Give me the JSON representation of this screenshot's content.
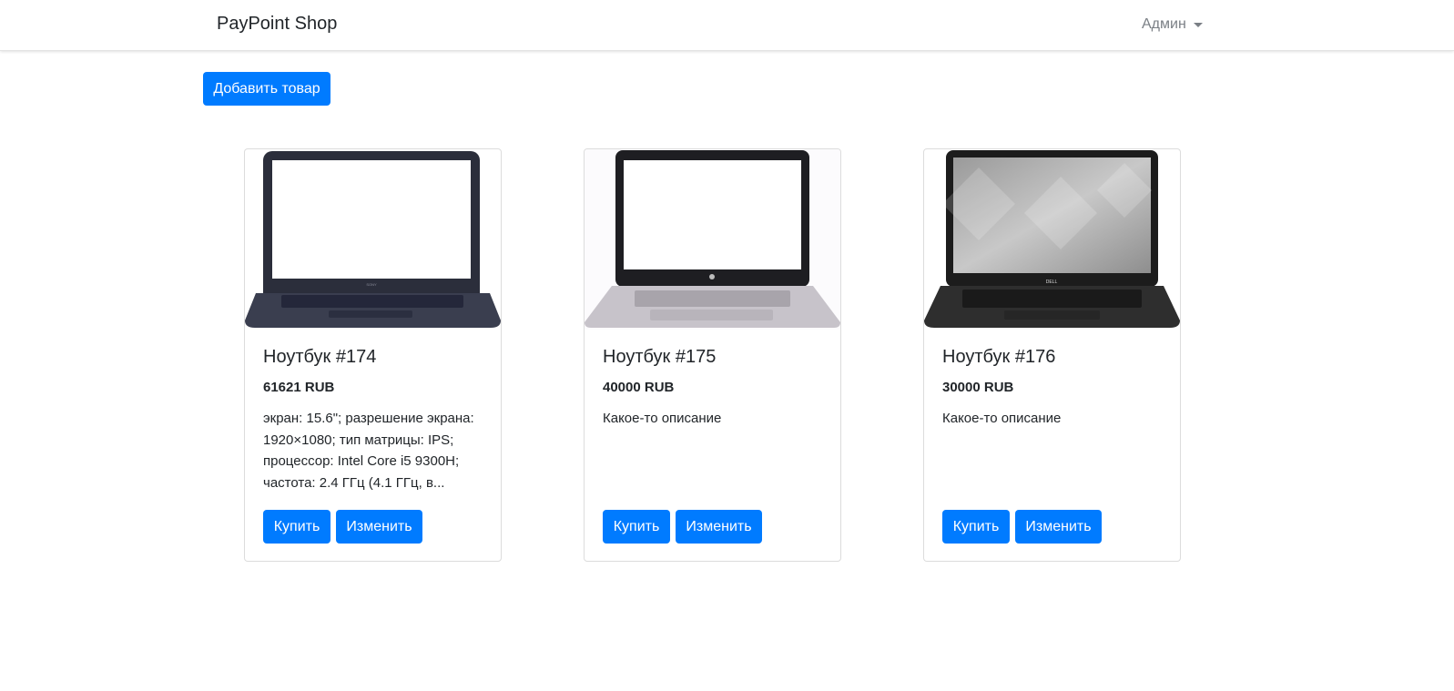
{
  "navbar": {
    "brand": "PayPoint Shop",
    "user_menu": "Админ",
    "user_menu_icon": "chevron-down-icon"
  },
  "toolbar": {
    "add_label": "Добавить товар"
  },
  "products": [
    {
      "title": "Ноутбук #174",
      "price": "61621 RUB",
      "description": "экран: 15.6\"; разрешение экрана: 1920×1080; тип матрицы: IPS; процессор: Intel Core i5 9300H; частота: 2.4 ГГц (4.1 ГГц, в...",
      "buy_label": "Купить",
      "edit_label": "Изменить",
      "image": "laptop-image"
    },
    {
      "title": "Ноутбук #175",
      "price": "40000 RUB",
      "description": "Какое-то описание",
      "buy_label": "Купить",
      "edit_label": "Изменить",
      "image": "laptop-image"
    },
    {
      "title": "Ноутбук #176",
      "price": "30000 RUB",
      "description": "Какое-то описание",
      "buy_label": "Купить",
      "edit_label": "Изменить",
      "image": "laptop-image"
    }
  ],
  "colors": {
    "primary": "#007bff",
    "text": "#212529",
    "muted": "#7a7f85"
  }
}
